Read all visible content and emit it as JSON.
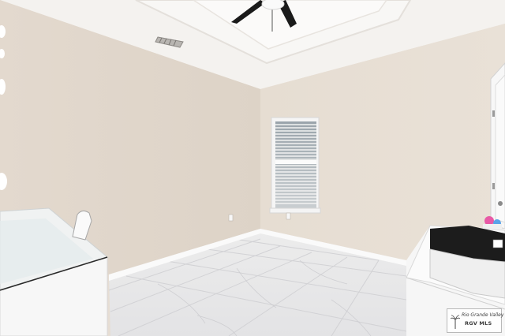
{
  "scene": {
    "description_colors": {
      "wall": "#e6ddd3",
      "wall_shadow": "#d9cfc4",
      "ceiling": "#f4f2ef",
      "floor": "#e9e9ea",
      "trim": "#fafafa",
      "fan": "#1a1a1a"
    }
  },
  "watermark": {
    "line1": "Rio Grande Valley",
    "line2": "RGV MLS"
  }
}
